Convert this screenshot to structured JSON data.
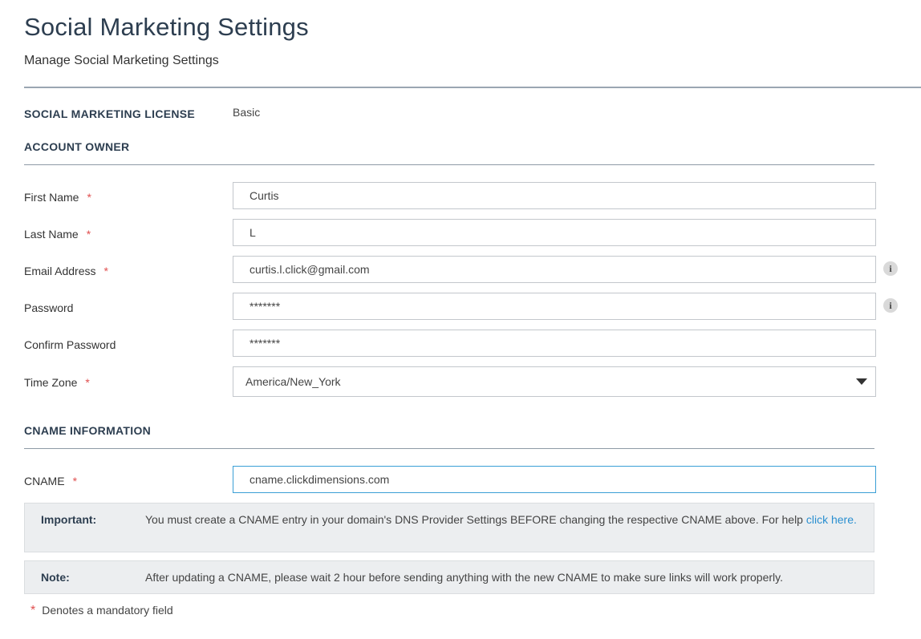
{
  "header": {
    "title": "Social Marketing Settings",
    "subtitle": "Manage Social Marketing Settings"
  },
  "license": {
    "label": "SOCIAL MARKETING LICENSE",
    "value": "Basic"
  },
  "account_owner": {
    "heading": "ACCOUNT OWNER",
    "first_name": {
      "label": "First Name",
      "value": "Curtis",
      "required": "*"
    },
    "last_name": {
      "label": "Last Name",
      "value": "L",
      "required": "*"
    },
    "email": {
      "label": "Email Address",
      "value": "curtis.l.click@gmail.com",
      "required": "*",
      "icon": "info-icon"
    },
    "password": {
      "label": "Password",
      "value": "*******",
      "icon": "info-icon"
    },
    "confirm_password": {
      "label": "Confirm Password",
      "value": "*******"
    },
    "time_zone": {
      "label": "Time Zone",
      "value": "America/New_York",
      "required": "*"
    }
  },
  "cname": {
    "heading": "CNAME INFORMATION",
    "label": "CNAME",
    "required": "*",
    "value": "cname.clickdimensions.com"
  },
  "important": {
    "label": "Important:",
    "text": "You must create a CNAME entry in your domain's DNS Provider Settings BEFORE changing the respective CNAME above. For help ",
    "link_text": "click here."
  },
  "note": {
    "label": "Note:",
    "text": "After updating a CNAME, please wait 2 hour before sending anything with the new CNAME to make sure links will work properly."
  },
  "footnote": {
    "star": "*",
    "text": "Denotes a mandatory field"
  },
  "colors": {
    "title": "#2d3e50",
    "required": "#e04f4f",
    "link": "#2a8fd0",
    "focus_border": "#3a9fd6",
    "notice_bg": "#eceef0"
  },
  "info_glyph": "i"
}
